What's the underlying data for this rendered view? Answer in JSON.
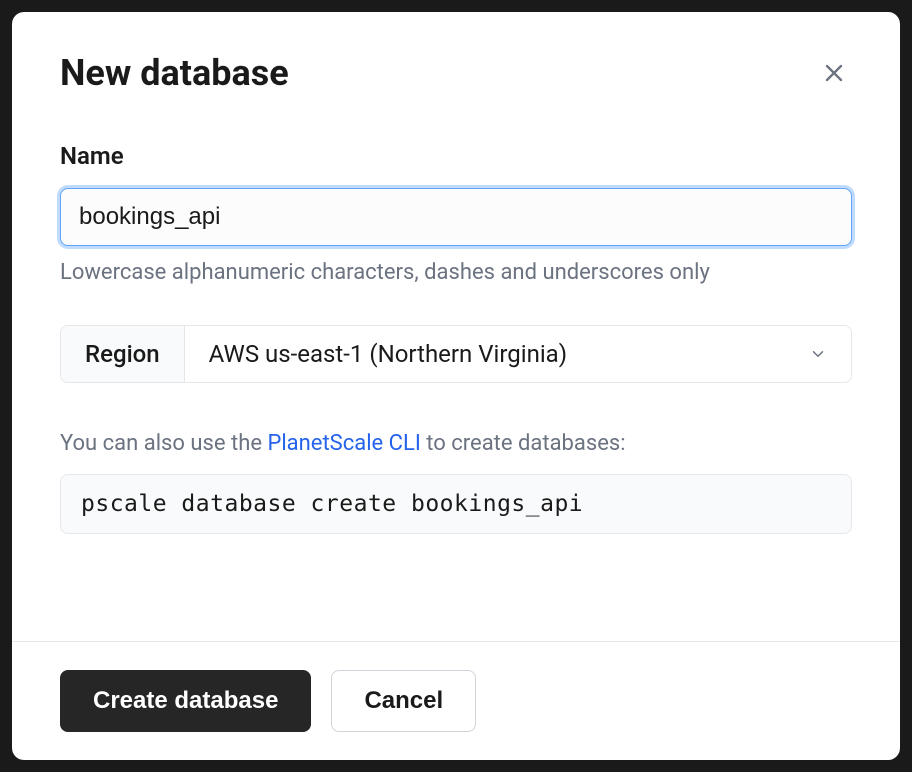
{
  "modal": {
    "title": "New database"
  },
  "nameField": {
    "label": "Name",
    "value": "bookings_api",
    "hint": "Lowercase alphanumeric characters, dashes and underscores only"
  },
  "regionField": {
    "label": "Region",
    "value": "AWS us-east-1 (Northern Virginia)"
  },
  "cli": {
    "hint_prefix": "You can also use the ",
    "link_text": "PlanetScale CLI",
    "hint_suffix": " to create databases:",
    "command": "pscale database create bookings_api"
  },
  "footer": {
    "primary": "Create database",
    "secondary": "Cancel"
  }
}
